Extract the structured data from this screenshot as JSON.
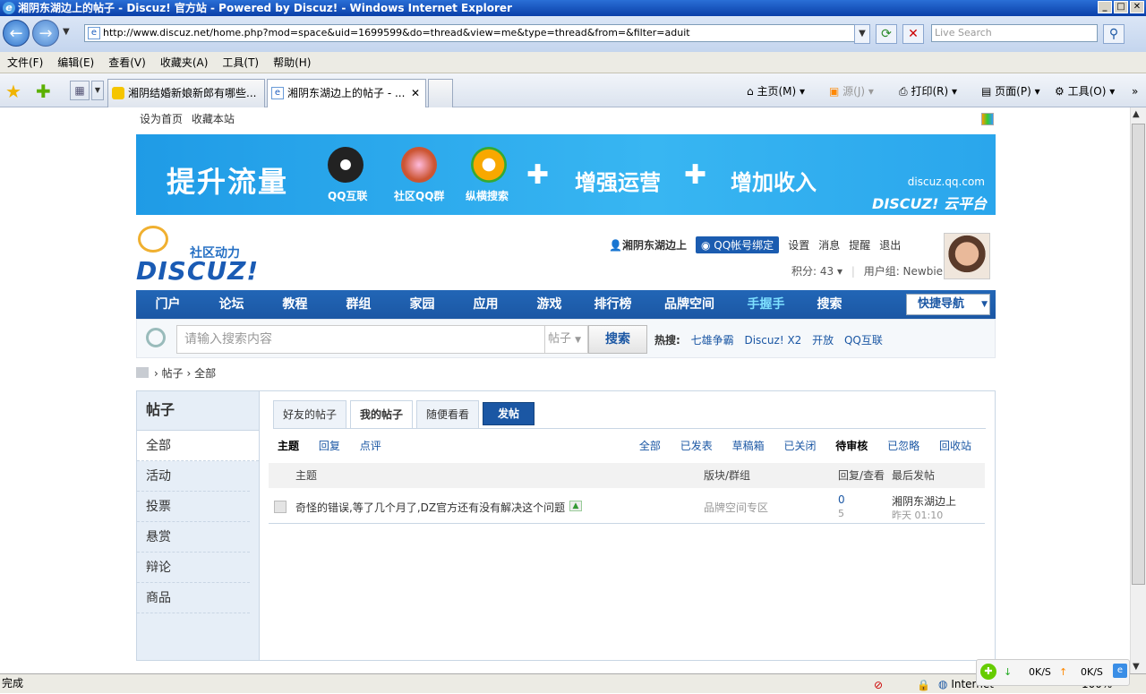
{
  "browser": {
    "title": "湘阴东湖边上的帖子 - Discuz! 官方站 - Powered by Discuz! - Windows Internet Explorer",
    "url": "http://www.discuz.net/home.php?mod=space&uid=1699599&do=thread&view=me&type=thread&from=&filter=aduit",
    "search_placeholder": "Live Search",
    "menu": [
      "文件(F)",
      "编辑(E)",
      "查看(V)",
      "收藏夹(A)",
      "工具(T)",
      "帮助(H)"
    ],
    "tabs": [
      "湘阴结婚新娘新郎有哪些...",
      "湘阴东湖边上的帖子 - ..."
    ],
    "toolbar": {
      "home": "主页(M)",
      "feeds": "源(J)",
      "print": "打印(R)",
      "page": "页面(P)",
      "tools": "工具(O)"
    },
    "status": "完成",
    "zone": "Internet",
    "zoom": "100%",
    "speed_down": "0K/S",
    "speed_up": "0K/S"
  },
  "site": {
    "toplinks": [
      "设为首页",
      "收藏本站"
    ],
    "banner": {
      "headline": "提升流量",
      "icons": [
        "QQ互联",
        "社区QQ群",
        "纵横搜索"
      ],
      "middle": "增强运营",
      "right": "增加收入",
      "url": "discuz.qq.com",
      "brand": "DISCUZ! 云平台"
    },
    "logo": {
      "subtitle": "社区动力",
      "word": "DISCUZ!"
    },
    "user": {
      "name": "湘阴东湖边上",
      "qq_bind": "QQ帐号绑定",
      "links": [
        "设置",
        "消息",
        "提醒",
        "退出"
      ],
      "points": "积分: 43",
      "group": "用户组: Newbie"
    },
    "nav": [
      "门户",
      "论坛",
      "教程",
      "群组",
      "家园",
      "应用",
      "游戏",
      "排行榜",
      "品牌空间",
      "手握手",
      "搜索"
    ],
    "quick_nav": "快捷导航",
    "search": {
      "placeholder": "请输入搜索内容",
      "type": "帖子",
      "button": "搜索",
      "hot_label": "热搜:",
      "hot": [
        "七雄争霸",
        "Discuz! X2",
        "开放",
        "QQ互联"
      ]
    },
    "breadcrumb": [
      "帖子",
      "全部"
    ]
  },
  "sidebar": {
    "title": "帖子",
    "items": [
      "全部",
      "活动",
      "投票",
      "悬赏",
      "辩论",
      "商品"
    ]
  },
  "content": {
    "tabs": [
      "好友的帖子",
      "我的帖子",
      "随便看看"
    ],
    "post_button": "发帖",
    "subnav": [
      "主题",
      "回复",
      "点评"
    ],
    "filters": [
      "全部",
      "已发表",
      "草稿箱",
      "已关闭",
      "待审核",
      "已忽略",
      "回收站"
    ],
    "columns": [
      "主题",
      "版块/群组",
      "回复/查看",
      "最后发帖"
    ],
    "rows": [
      {
        "title": "奇怪的错误,等了几个月了,DZ官方还有没有解决这个问题",
        "forum": "品牌空间专区",
        "replies": "0",
        "views": "5",
        "last_user": "湘阴东湖边上",
        "last_time": "昨天 01:10"
      }
    ]
  }
}
